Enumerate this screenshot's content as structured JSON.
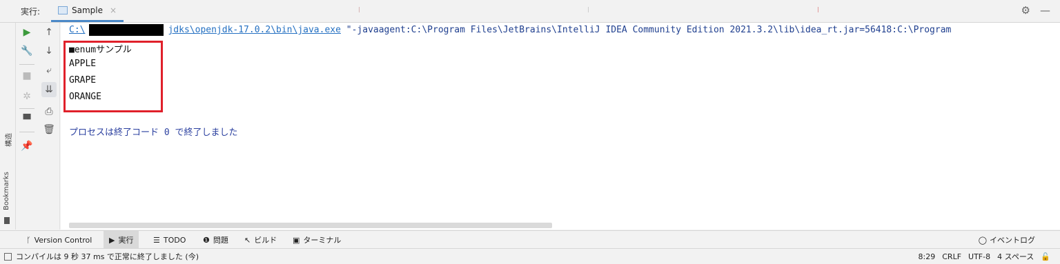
{
  "header": {
    "run_label": "実行:",
    "tab_name": "Sample",
    "tab_close": "×",
    "settings_icon": "⚙",
    "minimize_icon": "—"
  },
  "left_sidebar": {
    "structure_label": "構造",
    "bookmarks_label": "Bookmarks"
  },
  "console": {
    "cmd_prefix": "C:\\",
    "cmd_path": "jdks\\openjdk-17.0.2\\bin\\java.exe",
    "cmd_args": " \"-javaagent:C:\\Program Files\\JetBrains\\IntelliJ IDEA Community Edition 2021.3.2\\lib\\idea_rt.jar=56418:C:\\Program",
    "output_lines": [
      "■enumサンプル",
      "APPLE",
      "GRAPE",
      "ORANGE"
    ],
    "process_message": "プロセスは終了コード 0 で終了しました"
  },
  "tool_windows": {
    "version_control": "Version Control",
    "run": "実行",
    "todo": "TODO",
    "problems": "問題",
    "build": "ビルド",
    "terminal": "ターミナル",
    "event_log": "イベントログ"
  },
  "status_bar": {
    "message": "コンパイルは 9 秒 37 ms で正常に終了しました (今)",
    "position": "8:29",
    "line_separator": "CRLF",
    "encoding": "UTF-8",
    "indent": "4 スペース"
  }
}
